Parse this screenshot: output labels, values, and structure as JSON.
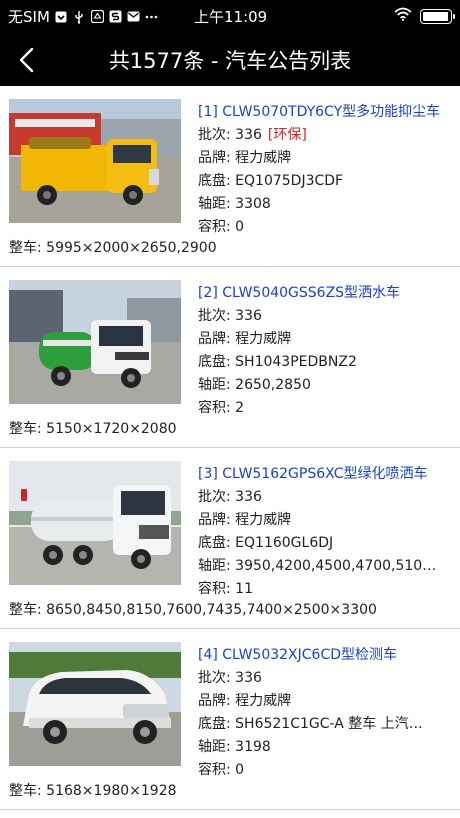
{
  "status": {
    "carrier": "无SIM",
    "time": "上午11:09",
    "battery_level": 0.95
  },
  "header": {
    "title": "共1577条 - 汽车公告列表",
    "back_icon": "chevron-left-icon"
  },
  "labels": {
    "batch": "批次: ",
    "brand": "品牌: ",
    "chassis": "底盘: ",
    "wheelbase": "轴距: ",
    "volume": "容积: ",
    "dims": "整车: "
  },
  "items": [
    {
      "title": "[1] CLW5070TDY6CY型多功能抑尘车",
      "batch": "336",
      "tag": "[环保]",
      "brand": "程力威牌",
      "chassis": "EQ1075DJ3CDF",
      "wheelbase": "3308",
      "volume": "0",
      "dims": "5995×2000×2650,2900",
      "image": "yellow-dust-suppression-truck"
    },
    {
      "title": "[2] CLW5040GSS6ZS型洒水车",
      "batch": "336",
      "brand": "程力威牌",
      "chassis": "SH1043PEDBNZ2",
      "wheelbase": "2650,2850",
      "volume": "2",
      "dims": "5150×1720×2080",
      "image": "white-green-sprinkler-truck"
    },
    {
      "title": "[3] CLW5162GPS6XC型绿化喷洒车",
      "batch": "336",
      "brand": "程力威牌",
      "chassis": "EQ1160GL6DJ",
      "wheelbase": "3950,4200,4500,4700,510…",
      "volume": "11",
      "dims": "8650,8450,8150,7600,7435,7400×2500×3300",
      "image": "white-tank-spray-truck"
    },
    {
      "title": "[4] CLW5032XJC6CD型检测车",
      "batch": "336",
      "brand": "程力威牌",
      "chassis": "SH6521C1GC-A 整车 上汽…",
      "wheelbase": "3198",
      "volume": "0",
      "dims": "5168×1980×1928",
      "image": "white-inspection-van"
    }
  ]
}
